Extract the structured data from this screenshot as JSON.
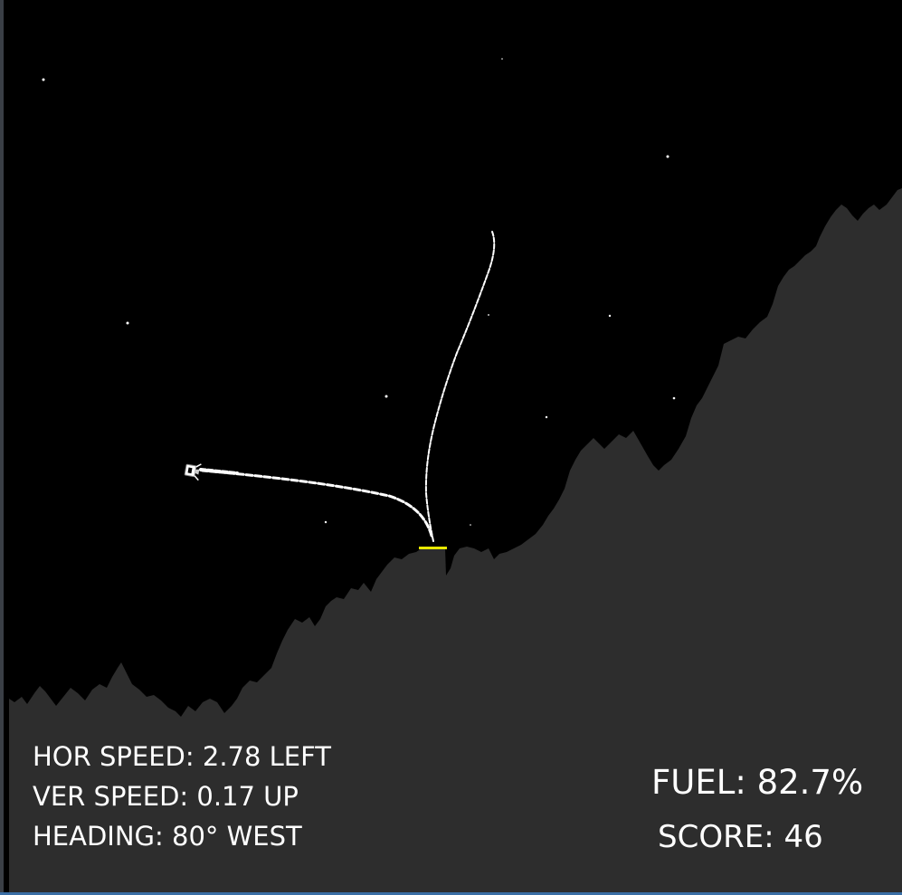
{
  "hud": {
    "horizontal_speed": "HOR SPEED: 2.78 LEFT",
    "vertical_speed": "VER SPEED: 0.17 UP",
    "heading": "HEADING: 80° WEST",
    "fuel": "FUEL: 82.7%",
    "score": "SCORE: 46"
  },
  "colors": {
    "sky": "#000000",
    "terrain": "#2d2d2d",
    "landing_pad": "#e8e800",
    "trail": "#ffffff",
    "hud_text": "#ffffff"
  }
}
